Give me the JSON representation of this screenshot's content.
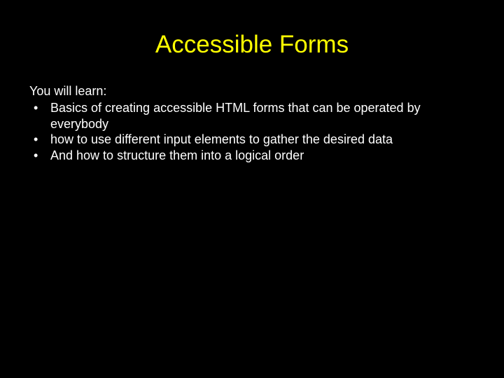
{
  "slide": {
    "title": "Accessible Forms",
    "intro": "You will learn:",
    "bullets": [
      " Basics of creating accessible HTML forms that can be operated by everybody",
      "how to use different input elements to gather the desired data",
      "And how to structure them into a logical order"
    ]
  }
}
